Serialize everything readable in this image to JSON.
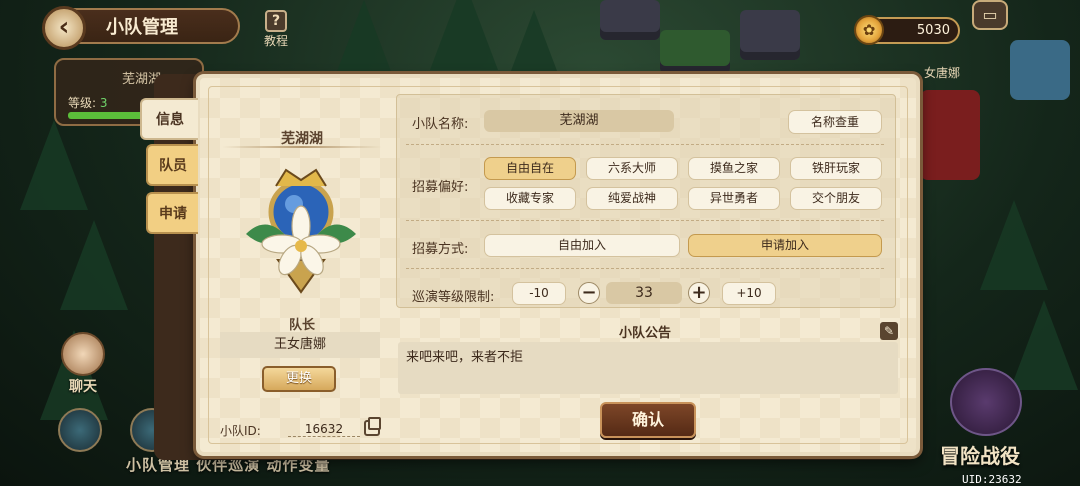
{
  "header": {
    "title": "小队管理",
    "tutorial_label": "教程",
    "tutorial_icon": "?",
    "coin_value": "5030"
  },
  "background": {
    "team_card_name": "芜湖湖",
    "level_label": "等级:",
    "level_value": "3",
    "chat_label": "聊天",
    "bottom_text": "小队管理  伙伴巡演  动作变量",
    "adventure_label": "冒险战役",
    "uid_text": "UID:23632",
    "right_name": "女唐娜"
  },
  "tabs": [
    {
      "label": "信息",
      "active": true
    },
    {
      "label": "队员",
      "active": false
    },
    {
      "label": "申请",
      "active": false
    }
  ],
  "profile": {
    "team_name": "芜湖湖",
    "leader_label": "队长",
    "leader_name": "王女唐娜",
    "change_label": "更换",
    "id_label": "小队ID:",
    "id_value": "16632"
  },
  "form": {
    "name_label": "小队名称:",
    "name_value": "芜湖湖",
    "name_check_label": "名称查重",
    "pref_label": "招募偏好:",
    "preferences": [
      {
        "label": "自由自在",
        "selected": true
      },
      {
        "label": "六系大师",
        "selected": false
      },
      {
        "label": "摸鱼之家",
        "selected": false
      },
      {
        "label": "铁肝玩家",
        "selected": false
      },
      {
        "label": "收藏专家",
        "selected": false
      },
      {
        "label": "纯爱战神",
        "selected": false
      },
      {
        "label": "异世勇者",
        "selected": false
      },
      {
        "label": "交个朋友",
        "selected": false
      }
    ],
    "method_label": "招募方式:",
    "methods": [
      {
        "label": "自由加入",
        "selected": false
      },
      {
        "label": "申请加入",
        "selected": true
      }
    ],
    "level_limit_label": "巡演等级限制:",
    "minus10_label": "-10",
    "minus_label": "−",
    "level_limit_value": "33",
    "plus_label": "+",
    "plus10_label": "+10"
  },
  "notice": {
    "title": "小队公告",
    "content": "来吧来吧，来者不拒",
    "edit_icon": "✎"
  },
  "confirm_label": "确认",
  "colors": {
    "panel_bg": "#f4ead2",
    "selected_pill": "#efd08c",
    "confirm": "#6a3620"
  }
}
